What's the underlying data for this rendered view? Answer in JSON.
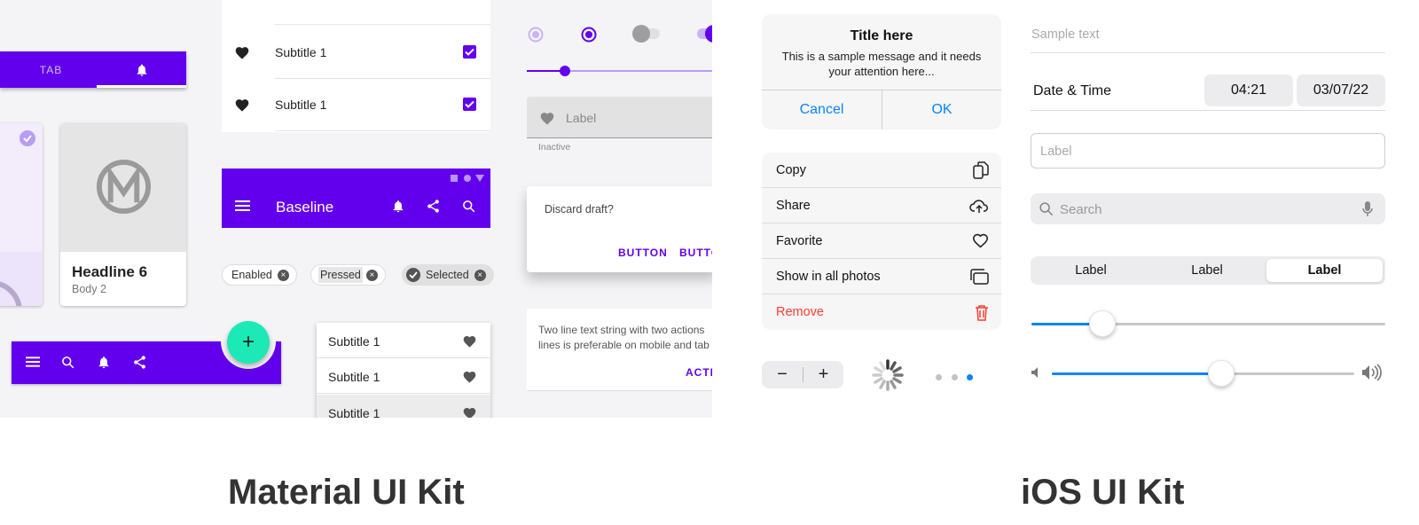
{
  "material": {
    "tab_label": "TAB",
    "card": {
      "headline": "Headline 6",
      "body": "Body 2"
    },
    "list_top": [
      {
        "label": "Subtitle 1"
      },
      {
        "label": "Subtitle 1"
      }
    ],
    "app_bar_title": "Baseline",
    "chips": {
      "enabled": "Enabled",
      "pressed": "Pressed",
      "selected": "Selected"
    },
    "list_menu": [
      {
        "label": "Subtitle 1"
      },
      {
        "label": "Subtitle 1"
      },
      {
        "label": "Subtitle 1"
      }
    ],
    "text_field": {
      "label": "Label",
      "helper": "Inactive"
    },
    "dialog": {
      "text": "Discard draft?",
      "button1": "BUTTON",
      "button2": "BUTTON"
    },
    "banner": {
      "line1": "Two line text string with two actions",
      "line2": "lines is preferable on mobile and tab",
      "action": "ACTIO"
    },
    "fab_label": "+",
    "kit_title": "Material UI Kit"
  },
  "ios": {
    "alert": {
      "title": "Title here",
      "message_line1": "This is a sample message and it needs",
      "message_line2": "your attention here...",
      "cancel": "Cancel",
      "ok": "OK"
    },
    "action_menu": [
      {
        "label": "Copy",
        "icon": "copy-icon"
      },
      {
        "label": "Share",
        "icon": "cloud-upload-icon"
      },
      {
        "label": "Favorite",
        "icon": "heart-icon"
      },
      {
        "label": "Show in all photos",
        "icon": "photos-icon"
      },
      {
        "label": "Remove",
        "icon": "trash-icon"
      }
    ],
    "stepper": {
      "minus": "−",
      "plus": "+"
    },
    "sample_text": "Sample text",
    "datetime": {
      "label": "Date & Time",
      "time": "04:21",
      "date": "03/07/22"
    },
    "text_field_placeholder": "Label",
    "search_placeholder": "Search",
    "segments": [
      "Label",
      "Label",
      "Label"
    ],
    "kit_title": "iOS UI Kit"
  },
  "colors": {
    "material_primary": "#6200ee",
    "fab": "#1de9b6",
    "ios_blue": "#0a84ff",
    "ios_red": "#ff3b30"
  },
  "progress": {
    "material_slider": 0.2,
    "ios_slider": 0.2,
    "ios_volume": 0.56
  }
}
